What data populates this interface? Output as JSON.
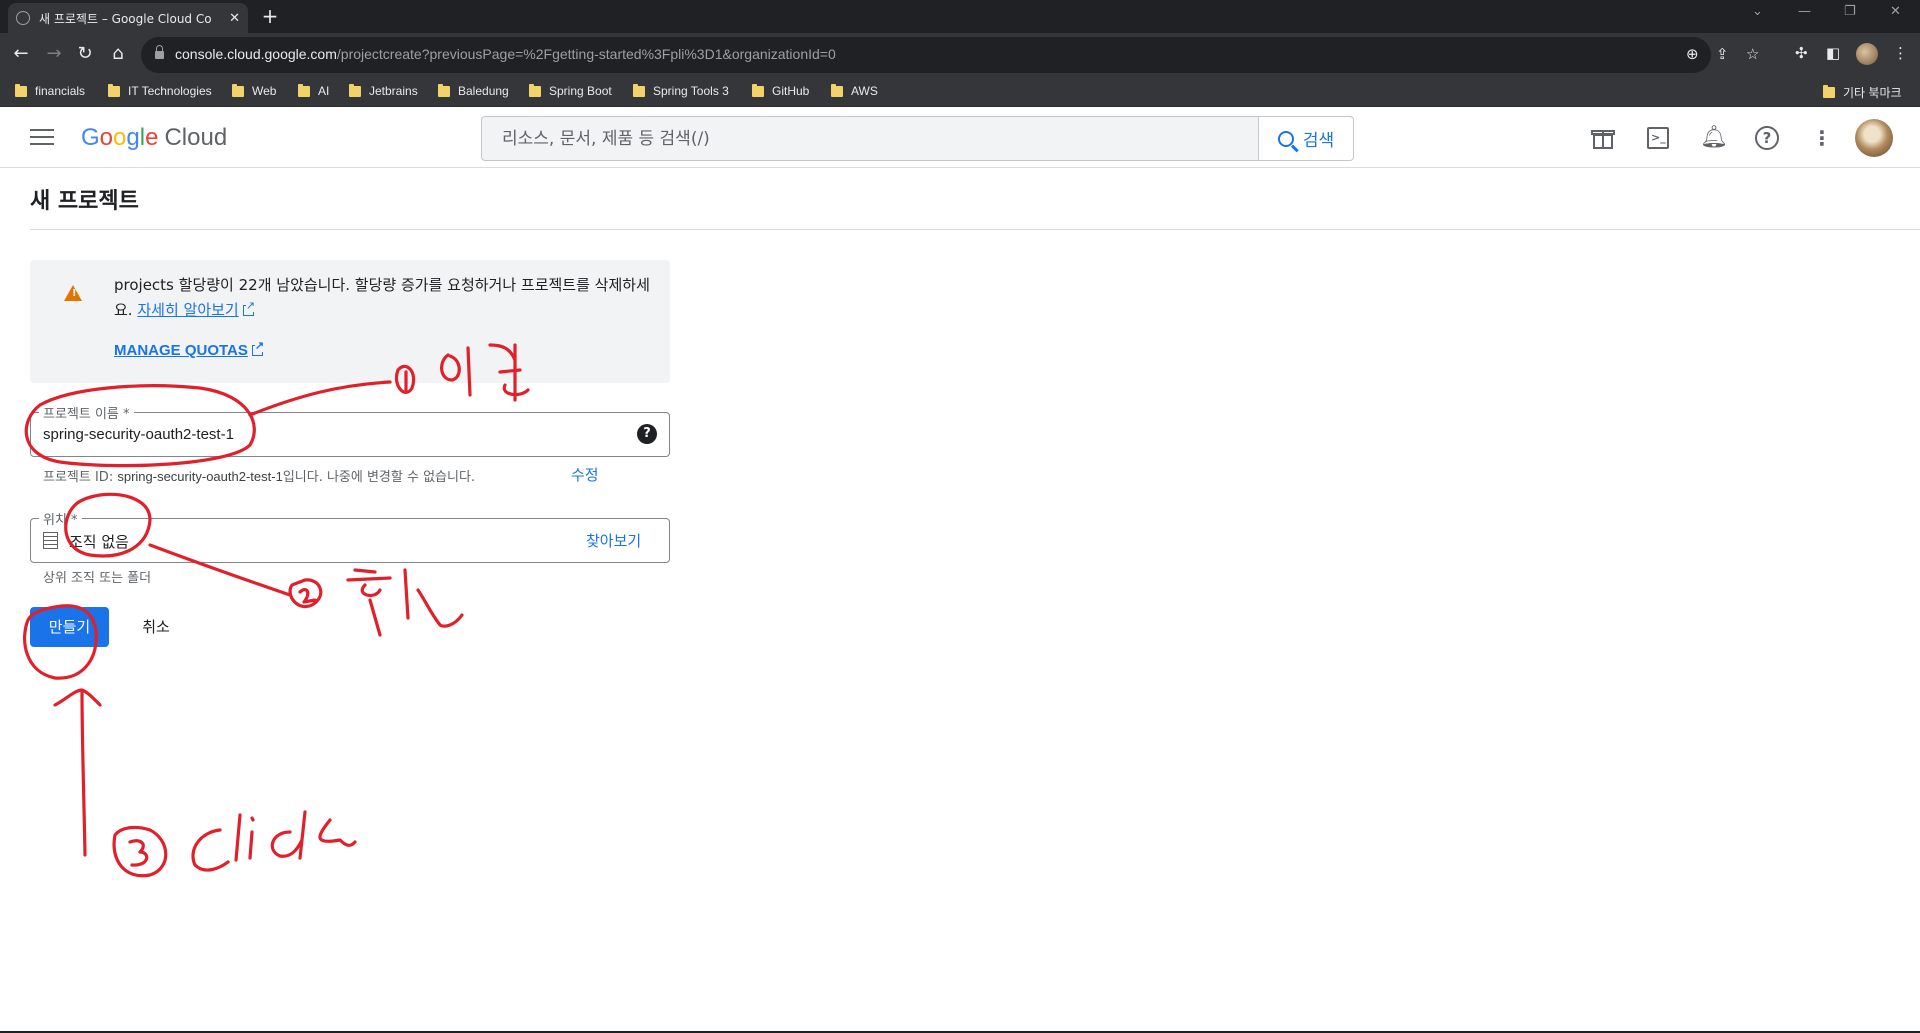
{
  "browser": {
    "tab_title": "새 프로젝트 – Google Cloud Co",
    "url_host": "console.cloud.google.com",
    "url_rest": "/projectcreate?previousPage=%2Fgetting-started%3Fpli%3D1&organizationId=0",
    "bookmarks": [
      "financials",
      "IT Technologies",
      "Web",
      "AI",
      "Jetbrains",
      "Baledung",
      "Spring Boot",
      "Spring Tools 3",
      "GitHub",
      "AWS"
    ],
    "other_bookmarks": "기타 북마크"
  },
  "header": {
    "logo_google": [
      "G",
      "o",
      "o",
      "g",
      "l",
      "e"
    ],
    "logo_cloud": "Cloud",
    "search_placeholder": "리소스, 문서, 제품 등 검색(/)",
    "search_button": "검색"
  },
  "page": {
    "title": "새 프로젝트",
    "quota": {
      "message": "projects 할당량이 22개 남았습니다. 할당량 증가를 요청하거나 프로젝트를 삭제하세요.",
      "learn_more": "자세히 알아보기",
      "manage_quotas": "MANAGE QUOTAS"
    },
    "project_name": {
      "label": "프로젝트 이름 *",
      "value": "spring-security-oauth2-test-1",
      "hint_prefix": "프로젝트 ID: ",
      "hint_id": "spring-security-oauth2-test-1",
      "hint_suffix": "입니다. 나중에 변경할 수 없습니다.",
      "edit": "수정"
    },
    "location": {
      "label": "위치 *",
      "value": "조직 없음",
      "browse": "찾아보기",
      "hint": "상위 조직 또는 폴더"
    },
    "create_button": "만들기",
    "cancel_button": "취소"
  },
  "annotations": {
    "color": "#e0202a",
    "step1": "①입력",
    "step2": "②확인",
    "step3": "③click"
  }
}
